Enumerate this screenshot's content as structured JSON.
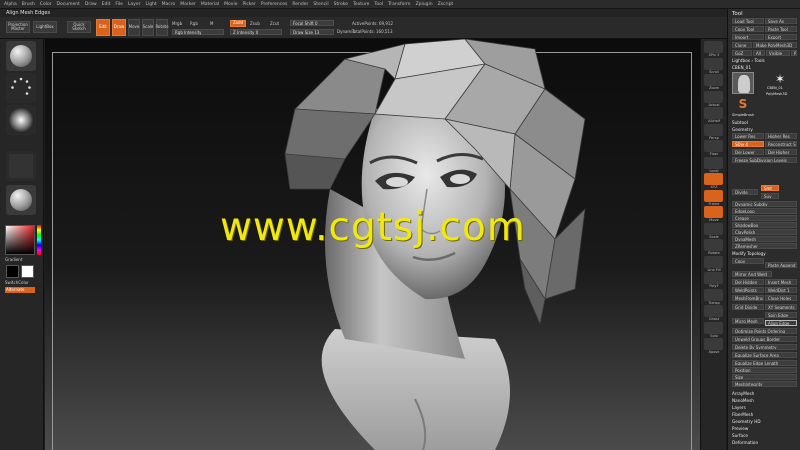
{
  "menu": [
    "Alpha",
    "Brush",
    "Color",
    "Document",
    "Draw",
    "Edit",
    "File",
    "Layer",
    "Light",
    "Macro",
    "Marker",
    "Material",
    "Movie",
    "Picker",
    "Preferences",
    "Render",
    "Stencil",
    "Stroke",
    "Texture",
    "Tool",
    "Transform",
    "Zplugin",
    "Zscript"
  ],
  "title": "Align Mesh Edges",
  "toolbar": {
    "projection_master": "Projection Master",
    "lightbox": "LightBox",
    "quick_sketch": "Quick Sketch",
    "edit": "Edit",
    "draw": "Draw",
    "move": "Move",
    "scale": "Scale",
    "rotate": "Rotate",
    "mrgb": "Mrgb",
    "rgb": "Rgb",
    "m": "M",
    "rgb_intensity": "Rgb Intensity",
    "zadd": "Zadd",
    "zsub": "Zsub",
    "zcut": "Zcut",
    "z_intensity": "Z Intensity 0",
    "focal_shift": "Focal Shift 0",
    "draw_size": "Draw Size 13",
    "dynamic": "Dynamic",
    "active_points": "ActivePoints: 69,912",
    "total_points": "TotalPoints: 160,513"
  },
  "left_shelf": {
    "gradient": "Gradient",
    "switch_color": "SwitchColor",
    "alternate": "Alternate"
  },
  "right_shelf": [
    "SPix 3",
    "Scroll",
    "Zoom",
    "Actual",
    "AAHalf",
    "Persp",
    "Floor",
    "Local",
    "XYZ",
    "Frame",
    "Move",
    "Scale",
    "Rotate",
    "Line Fill",
    "PolyF",
    "Transp",
    "Ghost",
    "Solo",
    "Xpose"
  ],
  "tool_panel": {
    "title": "Tool",
    "load_tool": "Load Tool",
    "save_as": "Save As",
    "copy_tool": "Copy Tool",
    "paste_tool": "Paste Tool",
    "import": "Import",
    "export": "Export",
    "clone": "Clone",
    "make_polymesh": "Make PolyMesh3D",
    "goz": "GoZ",
    "all": "All",
    "visible": "Visible",
    "r": "R",
    "lightbox_tools": "Lightbox › Tools",
    "current_tool": "CBEN_01",
    "thumb_label_1": "CBEN_01",
    "thumb_label_2": "PolyMesh3D",
    "thumb_label_3": "SimpleBrush",
    "subtool": "Subtool",
    "geometry": "Geometry",
    "lower_res": "Lower Res",
    "higher_res": "Higher Res",
    "sdiv": "SDiv 4",
    "reconstruct": "Reconstruct Subdiv",
    "del_lower": "Del Lower",
    "del_higher": "Del Higher",
    "freeze_subdiv": "Freeze SubDivision Levels",
    "divide": "Divide",
    "smt": "Smt",
    "suv": "Suv",
    "dynamic_subdiv": "Dynamic Subdiv",
    "edgeloop": "EdgeLoop",
    "crease": "Crease",
    "shadowbox": "ShadowBox",
    "claypolish": "ClayPolish",
    "dynamesh": "DynaMesh",
    "zremesher": "ZRemesher",
    "modify_topology": "Modify Topology",
    "copy": "Copy",
    "paste_append": "Paste Append",
    "mirror_weld": "Mirror And Weld",
    "del_hidden": "Del Hidden",
    "insert_mesh": "Insert Mesh",
    "weldpoints": "WeldPoints",
    "weld_dist": "WeldDist 1",
    "meshfromb": "MeshFromBrush",
    "close_holes": "Close Holes",
    "grid_divide": "Grid Divide",
    "xy_segments": "XY Segments",
    "spin_edge": "Spin Edge",
    "micro_mesh": "Micro Mesh",
    "align_edge": "Align Edge",
    "optimize_points": "Optimize Points Ordering",
    "unweld_groups": "Unweld Groups Border",
    "delete_symmetry": "Delete By Symmetry",
    "equalize_area": "Equalize Surface Area",
    "equalize_edge": "Equalize Edge Length",
    "position": "Position",
    "size": "Size",
    "meshintegrity": "MeshIntegrity",
    "arraymesh": "ArrayMesh",
    "nanomesh": "NanoMesh",
    "layers": "Layers",
    "fibermesh": "FiberMesh",
    "geometry_hd": "Geometry HD",
    "preview": "Preview",
    "surface": "Surface",
    "deformation": "Deformation"
  },
  "watermark": "www.cgtsj.com"
}
